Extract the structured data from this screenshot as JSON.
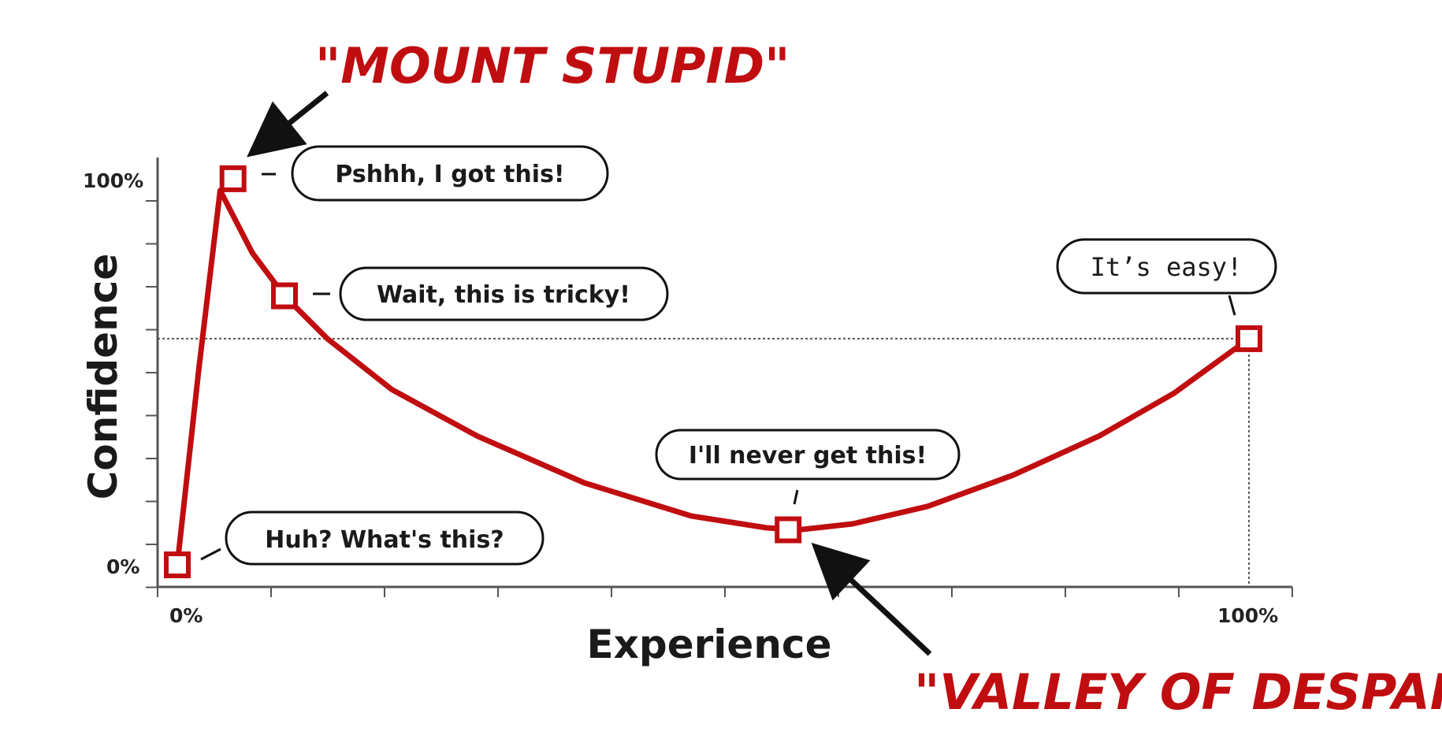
{
  "chart_data": {
    "type": "line",
    "xlabel": "Experience",
    "ylabel": "Confidence",
    "xlim": [
      0,
      100
    ],
    "ylim": [
      0,
      100
    ],
    "x_tick_labels": [
      "0%",
      "100%"
    ],
    "y_tick_labels": [
      "0%",
      "100%"
    ],
    "grid": false,
    "reference_lines": [
      {
        "axis": "y",
        "value": 58,
        "style": "dotted"
      },
      {
        "axis": "x",
        "value": 100,
        "style": "dotted"
      }
    ],
    "colors": {
      "curve": "#c00d10",
      "axes": "#555555",
      "label": "#c00d10"
    },
    "curve": {
      "x": [
        0,
        2,
        4,
        7,
        10,
        14,
        20,
        28,
        38,
        48,
        55,
        58,
        63,
        70,
        78,
        86,
        93,
        100
      ],
      "y": [
        0,
        50,
        96,
        80,
        69,
        58,
        45,
        33,
        21,
        12.5,
        9.5,
        9,
        10.5,
        15,
        23,
        33,
        44,
        58
      ]
    },
    "points": [
      {
        "x": 0,
        "y": 0,
        "callout": "Huh? What's this?"
      },
      {
        "x": 5.2,
        "y": 99,
        "callout": "Pshhh, I got this!"
      },
      {
        "x": 10,
        "y": 69,
        "callout": "Wait, this is tricky!"
      },
      {
        "x": 57,
        "y": 9,
        "callout": "I'll never get this!"
      },
      {
        "x": 100,
        "y": 58,
        "callout": "It’s easy!"
      }
    ],
    "annotations": [
      {
        "text": "\"MOUNT STUPID\"",
        "points_to": "peak"
      },
      {
        "text": "\"VALLEY OF DESPAIR\"",
        "points_to": "trough"
      }
    ]
  }
}
